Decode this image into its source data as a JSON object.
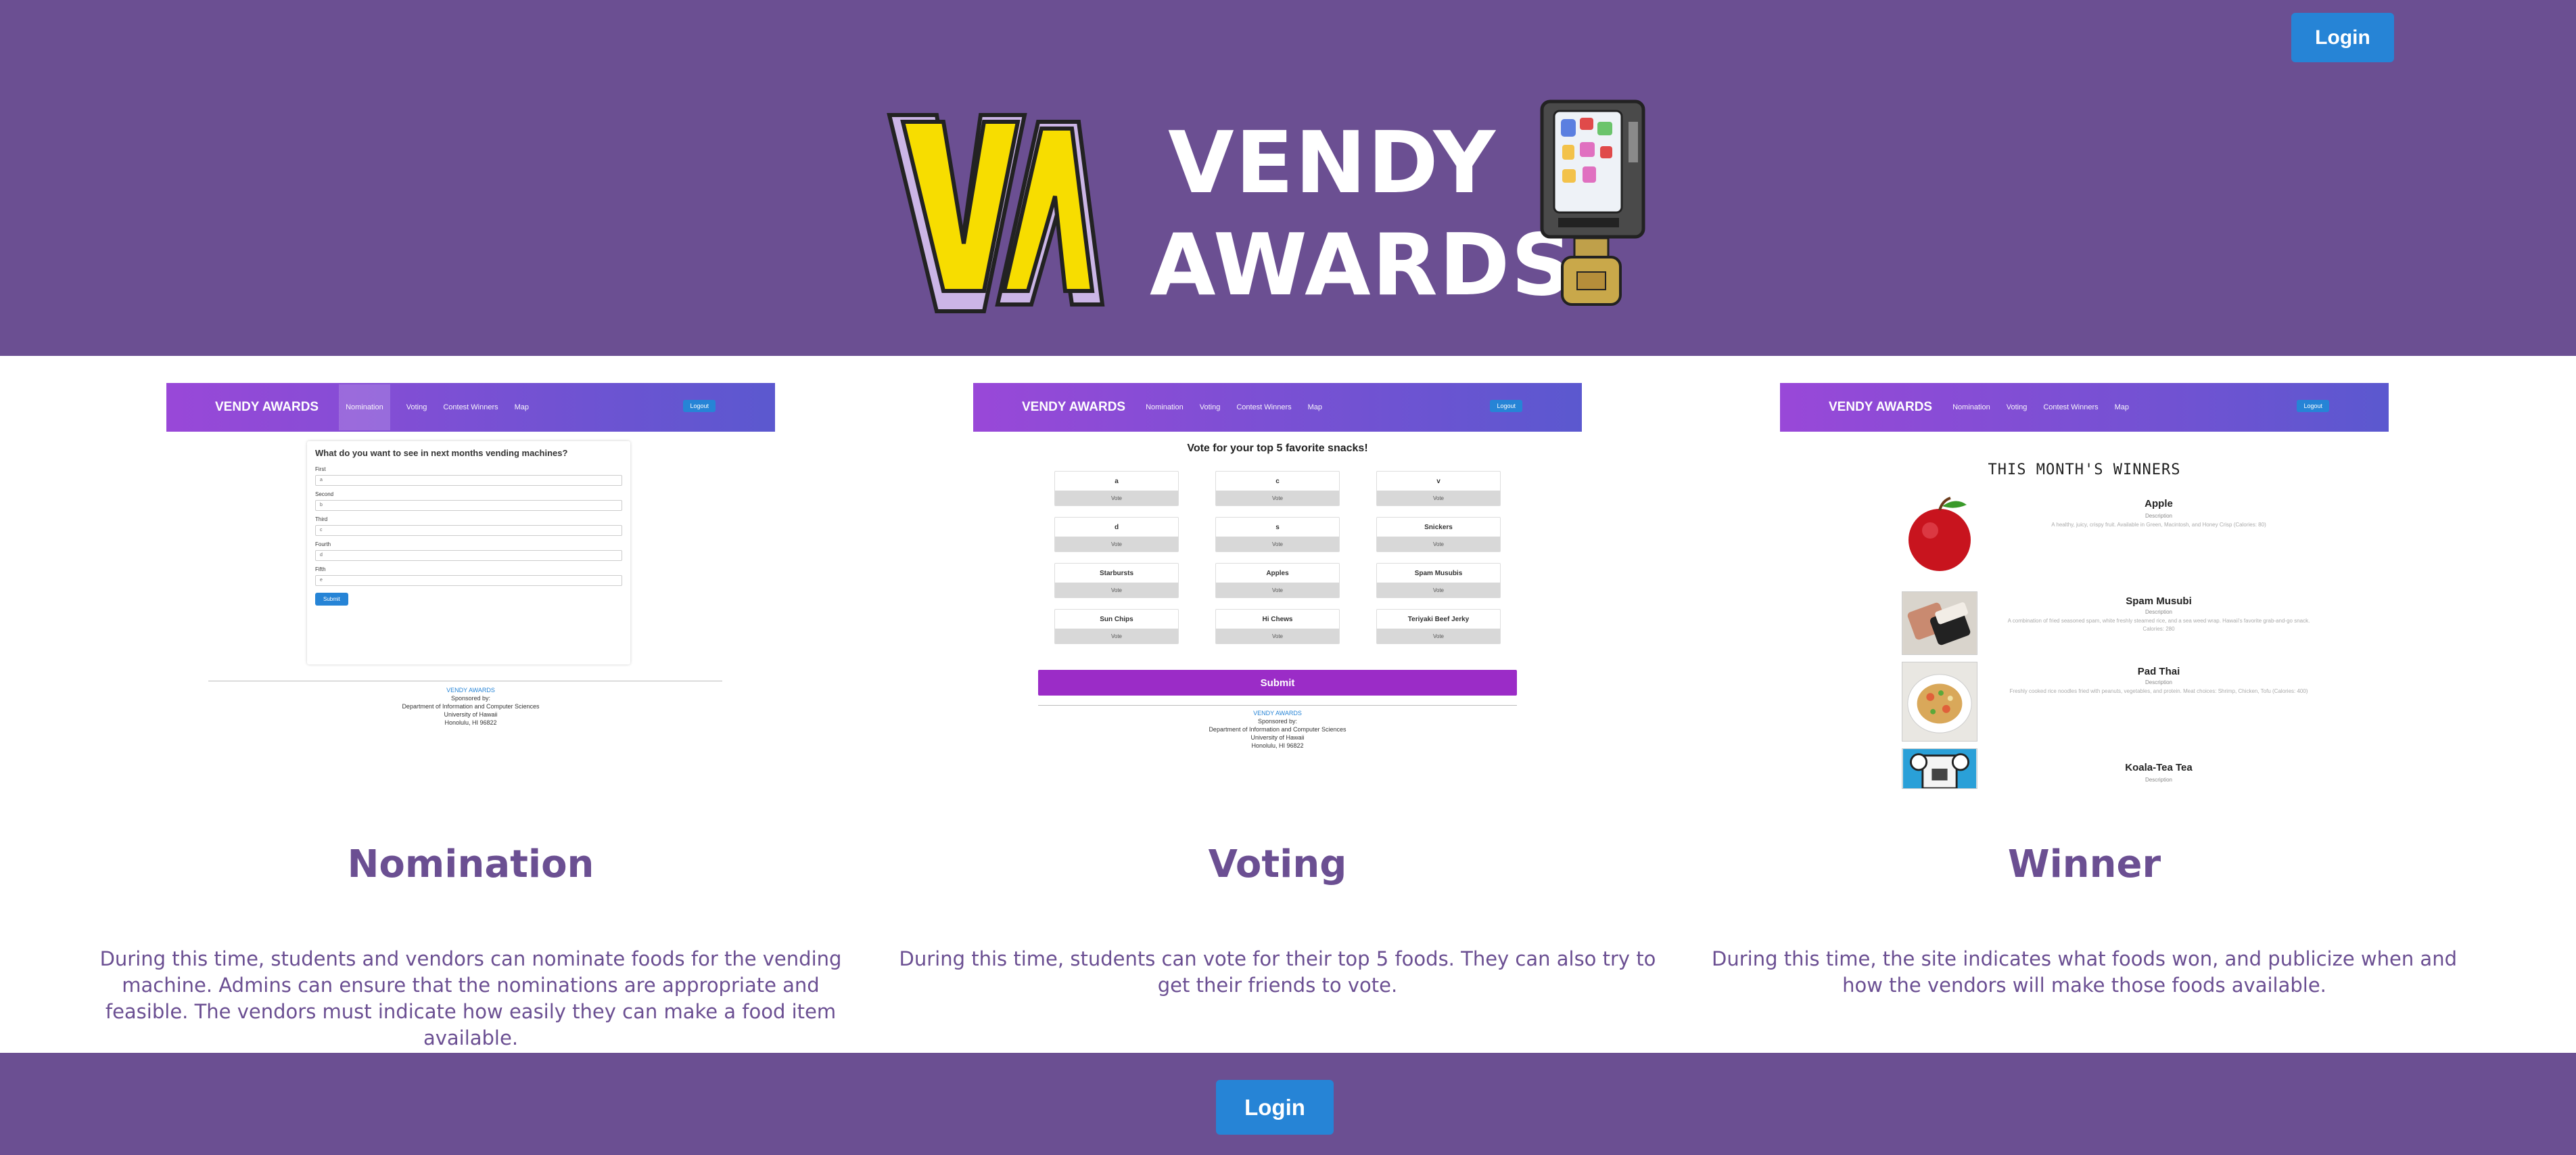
{
  "header": {
    "login": "Login",
    "title_line1": "VENDY",
    "title_line2": "AWARDS",
    "logo_letters": "VA"
  },
  "nav": {
    "brand": "VENDY AWARDS",
    "items": [
      "Nomination",
      "Voting",
      "Contest Winners",
      "Map"
    ],
    "logout": "Logout"
  },
  "nomination_shot": {
    "question": "What do you want to see in next months vending machines?",
    "fields": [
      {
        "label": "First",
        "value": "a"
      },
      {
        "label": "Second",
        "value": "b"
      },
      {
        "label": "Third",
        "value": "c"
      },
      {
        "label": "Fourth",
        "value": "d"
      },
      {
        "label": "Fifth",
        "value": "e"
      }
    ],
    "submit": "Submit"
  },
  "voting_shot": {
    "title": "Vote for your top 5 favorite snacks!",
    "items": [
      "a",
      "c",
      "v",
      "d",
      "s",
      "Snickers",
      "Starbursts",
      "Apples",
      "Spam Musubis",
      "Sun Chips",
      "Hi Chews",
      "Teriyaki Beef Jerky"
    ],
    "vote_label": "Vote",
    "submit": "Submit"
  },
  "winners_shot": {
    "title": "THIS MONTH'S WINNERS",
    "desc_label": "Description",
    "items": [
      {
        "name": "Apple",
        "desc": "A healthy, juicy, crispy fruit. Available in Green, Macintosh, and Honey Crisp (Calories: 80)"
      },
      {
        "name": "Spam Musubi",
        "desc": "A combination of fried seasoned spam, white freshly steamed rice, and a sea weed wrap. Hawaii's favorite grab-and-go snack. Calories: 280"
      },
      {
        "name": "Pad Thai",
        "desc": "Freshly cooked rice noodles fried with peanuts, vegetables, and protein. Meat choices: Shrimp, Chicken, Tofu (Calories: 400)"
      },
      {
        "name": "Koala-Tea Tea",
        "desc": ""
      }
    ]
  },
  "footer_info": [
    "VENDY AWARDS",
    "Sponsored by:",
    "Department of Information and Computer Sciences",
    "University of Hawaii",
    "Honolulu, HI 96822"
  ],
  "sections": [
    {
      "title": "Nomination",
      "text": "During this time, students and vendors can nominate foods for the vending machine. Admins can ensure that the nominations are appropriate and feasible. The vendors must indicate how easily they can make a food item available."
    },
    {
      "title": "Voting",
      "text": "During this time, students can vote for their top 5 foods. They can also try to get their friends to vote."
    },
    {
      "title": "Winner",
      "text": "During this time, the site indicates what foods won, and publicize when and how the vendors will make those foods available."
    }
  ],
  "footer": {
    "login": "Login"
  },
  "colors": {
    "brand_purple": "#6b4f92",
    "button_blue": "#2684d6",
    "nav_gradient_start": "#9948d8",
    "nav_gradient_end": "#5b58cf",
    "vote_submit": "#9b2cc7"
  }
}
